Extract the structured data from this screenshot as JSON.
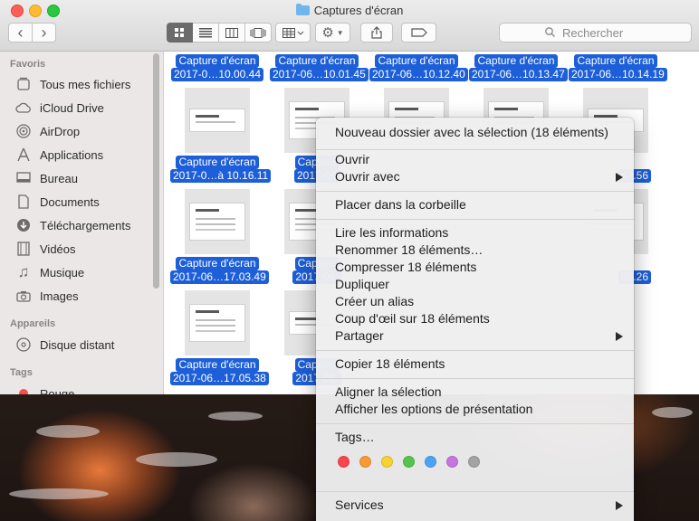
{
  "window": {
    "title": "Captures d'écran"
  },
  "toolbar": {
    "back": "‹",
    "forward": "›",
    "search_placeholder": "Rechercher"
  },
  "sidebar": {
    "favorites_heading": "Favoris",
    "favorites": [
      {
        "label": "Tous mes fichiers",
        "icon": "all-files-icon"
      },
      {
        "label": "iCloud Drive",
        "icon": "cloud-icon"
      },
      {
        "label": "AirDrop",
        "icon": "airdrop-icon"
      },
      {
        "label": "Applications",
        "icon": "applications-icon"
      },
      {
        "label": "Bureau",
        "icon": "desktop-icon"
      },
      {
        "label": "Documents",
        "icon": "documents-icon"
      },
      {
        "label": "Téléchargements",
        "icon": "downloads-icon"
      },
      {
        "label": "Vidéos",
        "icon": "film-icon"
      },
      {
        "label": "Musique",
        "icon": "music-note-icon"
      },
      {
        "label": "Images",
        "icon": "camera-icon"
      }
    ],
    "devices_heading": "Appareils",
    "devices": [
      {
        "label": "Disque distant",
        "icon": "disc-icon"
      }
    ],
    "tags_heading": "Tags",
    "tags": [
      {
        "label": "Rouge",
        "color": "#fc4d4d"
      }
    ]
  },
  "files": [
    {
      "line1": "Capture d'écran",
      "line2": "2017-0…10.00.44"
    },
    {
      "line1": "Capture d'écran",
      "line2": "2017-06…10.01.45"
    },
    {
      "line1": "Capture d'écran",
      "line2": "2017-06…10.12.40"
    },
    {
      "line1": "Capture d'écran",
      "line2": "2017-06…10.13.47"
    },
    {
      "line1": "Capture d'écran",
      "line2": "2017-06…10.14.19"
    },
    {
      "line1": "Capture d'écran",
      "line2": "2017-0…à 10.16.11"
    },
    {
      "line1": "Capture",
      "line2": "2017-06"
    },
    {
      "line1": "",
      "line2": "47.56"
    },
    {
      "line1": "Capture d'écran",
      "line2": "2017-06…17.03.49"
    },
    {
      "line1": "Capture",
      "line2": "2017-06."
    },
    {
      "line1": "",
      "line2": "05.26"
    },
    {
      "line1": "Capture d'écran",
      "line2": "2017-06…17.05.38"
    },
    {
      "line1": "Capture",
      "line2": "2017-06."
    }
  ],
  "context_menu": {
    "new_folder": "Nouveau dossier avec la sélection (18 éléments)",
    "open": "Ouvrir",
    "open_with": "Ouvrir avec",
    "trash": "Placer dans la corbeille",
    "get_info": "Lire les informations",
    "rename": "Renommer 18 éléments…",
    "compress": "Compresser 18 éléments",
    "duplicate": "Dupliquer",
    "alias": "Créer un alias",
    "quick_look": "Coup d'œil sur 18 éléments",
    "share": "Partager",
    "copy": "Copier 18 éléments",
    "align": "Aligner la sélection",
    "view_options": "Afficher les options de présentation",
    "tags": "Tags…",
    "tag_colors": [
      "#f7474d",
      "#f79a35",
      "#f6d232",
      "#55c44b",
      "#4aa3f4",
      "#c574e0",
      "#a3a3a3"
    ],
    "services": "Services"
  }
}
